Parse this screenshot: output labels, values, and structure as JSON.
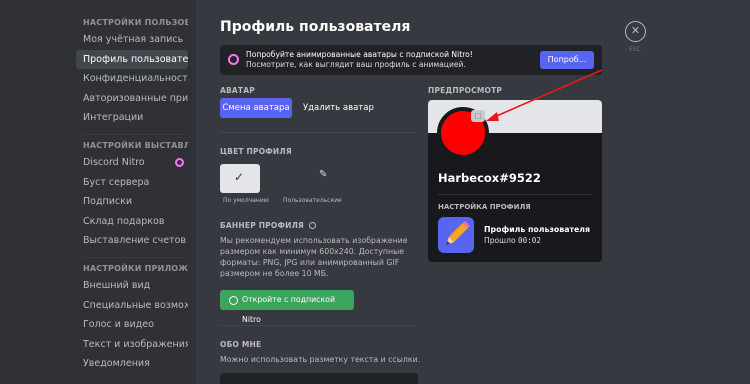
{
  "sidebar": {
    "sections": [
      {
        "header": "НАСТРОЙКИ ПОЛЬЗОВАТЕ...",
        "items": [
          {
            "label": "Моя учётная запись"
          },
          {
            "label": "Профиль пользователя",
            "active": true
          },
          {
            "label": "Конфиденциальность"
          },
          {
            "label": "Авторизованные прил..."
          },
          {
            "label": "Интеграции"
          }
        ]
      },
      {
        "header": "НАСТРОЙКИ ВЫСТАВЛЕН...",
        "items": [
          {
            "label": "Discord Nitro",
            "icon": "nitro-icon"
          },
          {
            "label": "Буст сервера"
          },
          {
            "label": "Подписки"
          },
          {
            "label": "Склад подарков"
          },
          {
            "label": "Выставление счетов"
          }
        ]
      },
      {
        "header": "НАСТРОЙКИ ПРИЛОЖЕНИЯ",
        "items": [
          {
            "label": "Внешний вид"
          },
          {
            "label": "Специальные возмож..."
          },
          {
            "label": "Голос и видео"
          },
          {
            "label": "Текст и изображения"
          },
          {
            "label": "Уведомления"
          }
        ]
      }
    ]
  },
  "main": {
    "title": "Профиль пользователя",
    "nitro_banner": {
      "text_bold": "Попробуйте анимированные аватары с подпиской Nitro!",
      "text_rest": " Посмотрите, как выглядит ваш профиль с анимацией.",
      "button": "Попроб..."
    },
    "avatar": {
      "label": "АВАТАР",
      "change_button": "Смена аватара",
      "remove_button": "Удалить аватар"
    },
    "profile_color": {
      "label": "ЦВЕТ ПРОФИЛЯ",
      "default_label": "По умолчанию",
      "custom_label": "Пользовательские",
      "default_color": "#e3e5e8",
      "custom_color": "#dcddde"
    },
    "profile_banner": {
      "label": "БАННЕР ПРОФИЛЯ",
      "description": "Мы рекомендуем использовать изображение размером как минимум 600x240. Доступные форматы: PNG, JPG или анимированный GIF размером не более 10 МБ.",
      "button": "Откройте с подпиской Nitro"
    },
    "about": {
      "label": "ОБО МНЕ",
      "description": "Можно использовать разметку текста и ссылки."
    },
    "preview": {
      "label": "ПРЕДПРОСМОТР",
      "username": "Harbecox#9522",
      "section": "НАСТРОЙКА ПРОФИЛЯ",
      "activity_title": "Профиль пользователя",
      "activity_prefix": "Прошло ",
      "activity_time": "00:02",
      "avatar_color": "#ff0000",
      "banner_color": "#e3e5e8"
    },
    "close": {
      "label": "ESC"
    }
  },
  "colors": {
    "accent": "#5865f2",
    "green": "#3ba55c",
    "nitro": "#ff73fa",
    "annotation_arrow": "#e8171c"
  }
}
